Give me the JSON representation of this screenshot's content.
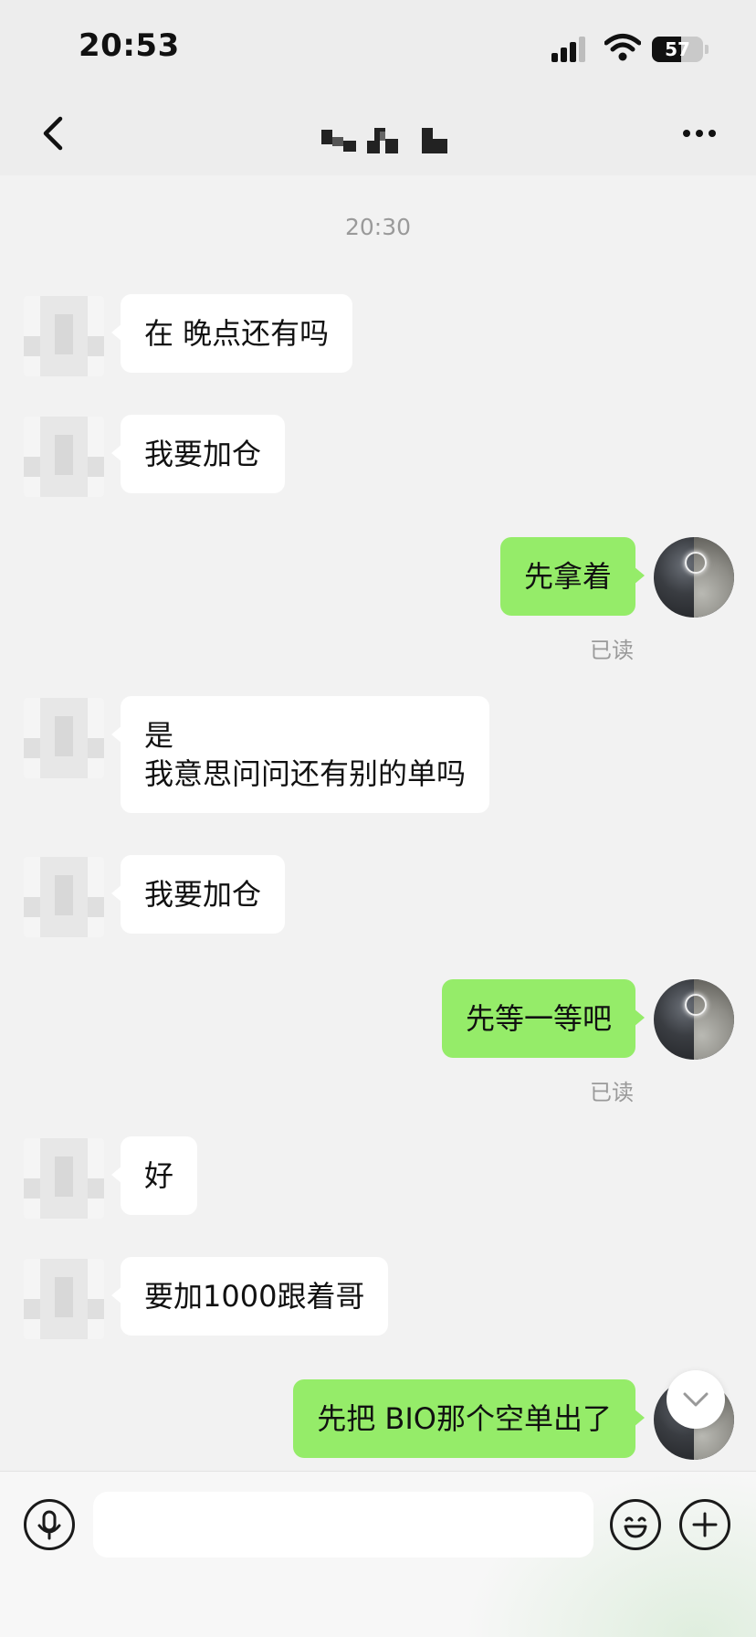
{
  "status_bar": {
    "time": "20:53",
    "battery_level": "57"
  },
  "header": {
    "title_obscured": true
  },
  "chat": {
    "timestamp": "20:30",
    "messages": [
      {
        "from": "other",
        "text": "在 晚点还有吗"
      },
      {
        "from": "other",
        "text": "我要加仓"
      },
      {
        "from": "self",
        "text": "先拿着",
        "status": "已读"
      },
      {
        "from": "other",
        "line1": "是",
        "line2": "我意思问问还有别的单吗"
      },
      {
        "from": "other",
        "text": "我要加仓"
      },
      {
        "from": "self",
        "text": "先等一等吧",
        "status": "已读"
      },
      {
        "from": "other",
        "text": "好"
      },
      {
        "from": "other",
        "text": "要加1000跟着哥"
      },
      {
        "from": "self",
        "text": "先把 BIO那个空单出了"
      }
    ]
  },
  "input_bar": {
    "value": "",
    "icons": [
      "microphone-icon",
      "emoji-icon",
      "plus-icon"
    ]
  },
  "colors": {
    "self_bubble": "#95ec69",
    "other_bubble": "#ffffff",
    "background": "#f2f2f2"
  }
}
